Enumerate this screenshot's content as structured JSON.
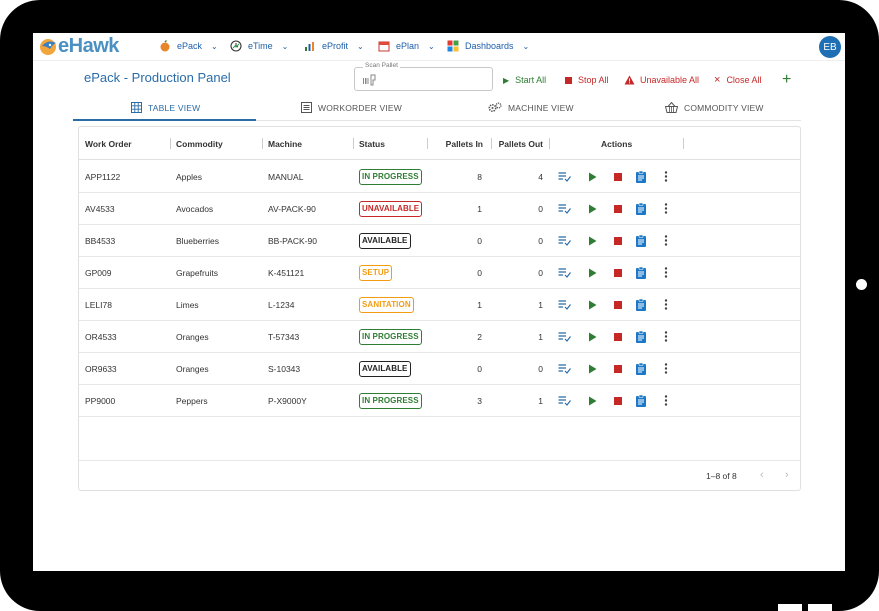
{
  "app": {
    "logo_text": "eHawk",
    "avatar": "EB"
  },
  "nav": [
    {
      "label": "ePack",
      "icon": "fruit-icon"
    },
    {
      "label": "eTime",
      "icon": "clock-icon"
    },
    {
      "label": "eProfit",
      "icon": "chart-icon"
    },
    {
      "label": "ePlan",
      "icon": "calendar-icon"
    },
    {
      "label": "Dashboards",
      "icon": "dashboard-icon"
    }
  ],
  "header": {
    "title": "ePack - Production Panel",
    "scan_label": "Scan Pallet",
    "actions": {
      "start_all": "Start All",
      "stop_all": "Stop All",
      "unavailable_all": "Unavailable All",
      "close_all": "Close All"
    },
    "colors": {
      "start": "#2e7d32",
      "stop": "#c62828",
      "primary": "#2a6ca8"
    }
  },
  "tabs": [
    {
      "label": "TABLE VIEW",
      "icon": "table-icon",
      "active": true
    },
    {
      "label": "WORKORDER VIEW",
      "icon": "list-icon",
      "active": false
    },
    {
      "label": "MACHINE VIEW",
      "icon": "gears-icon",
      "active": false
    },
    {
      "label": "COMMODITY VIEW",
      "icon": "basket-icon",
      "active": false
    }
  ],
  "table": {
    "columns": [
      "Work Order",
      "Commodity",
      "Machine",
      "Status",
      "Pallets In",
      "Pallets Out",
      "Actions"
    ],
    "rows": [
      {
        "work_order": "APP1122",
        "commodity": "Apples",
        "machine": "MANUAL",
        "status": "IN PROGRESS",
        "status_color": "#2e7d32",
        "pallets_in": "8",
        "pallets_out": "4"
      },
      {
        "work_order": "AV4533",
        "commodity": "Avocados",
        "machine": "AV-PACK-90",
        "status": "UNAVAILABLE",
        "status_color": "#c62828",
        "pallets_in": "1",
        "pallets_out": "0"
      },
      {
        "work_order": "BB4533",
        "commodity": "Blueberries",
        "machine": "BB-PACK-90",
        "status": "AVAILABLE",
        "status_color": "#222222",
        "pallets_in": "0",
        "pallets_out": "0"
      },
      {
        "work_order": "GP009",
        "commodity": "Grapefruits",
        "machine": "K-451121",
        "status": "SETUP",
        "status_color": "#f39c12",
        "pallets_in": "0",
        "pallets_out": "0"
      },
      {
        "work_order": "LELI78",
        "commodity": "Limes",
        "machine": "L-1234",
        "status": "SANITATION",
        "status_color": "#f39c12",
        "pallets_in": "1",
        "pallets_out": "1"
      },
      {
        "work_order": "OR4533",
        "commodity": "Oranges",
        "machine": "T-57343",
        "status": "IN PROGRESS",
        "status_color": "#2e7d32",
        "pallets_in": "2",
        "pallets_out": "1"
      },
      {
        "work_order": "OR9633",
        "commodity": "Oranges",
        "machine": "S-10343",
        "status": "AVAILABLE",
        "status_color": "#222222",
        "pallets_in": "0",
        "pallets_out": "0"
      },
      {
        "work_order": "PP9000",
        "commodity": "Peppers",
        "machine": "P-X9000Y",
        "status": "IN PROGRESS",
        "status_color": "#2e7d32",
        "pallets_in": "3",
        "pallets_out": "1"
      }
    ],
    "row_action_icons": [
      "queue-list-icon",
      "play-icon",
      "stop-icon",
      "clipboard-icon",
      "more-vert-icon"
    ],
    "pagination": "1–8 of 8"
  }
}
